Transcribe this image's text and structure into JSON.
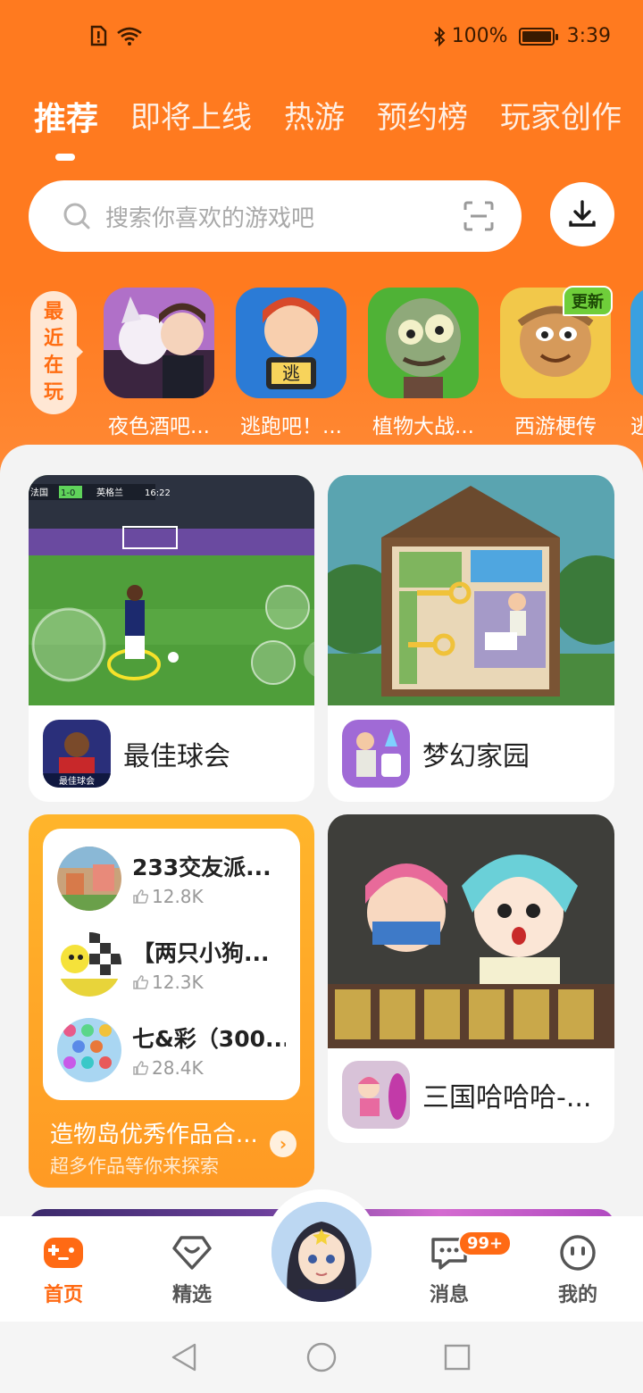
{
  "status_bar": {
    "battery": "100%",
    "time": "3:39"
  },
  "tabs": [
    {
      "label": "推荐"
    },
    {
      "label": "即将上线"
    },
    {
      "label": "热游"
    },
    {
      "label": "预约榜"
    },
    {
      "label": "玩家创作"
    }
  ],
  "search": {
    "placeholder": "搜索你喜欢的游戏吧"
  },
  "recent": {
    "label_chars": [
      "最",
      "近",
      "在",
      "玩"
    ],
    "items": [
      {
        "name": "夜色酒吧..."
      },
      {
        "name": "逃跑吧！..."
      },
      {
        "name": "植物大战..."
      },
      {
        "name": "西游梗传",
        "badge": "更新"
      },
      {
        "name": "逃"
      }
    ]
  },
  "cards": [
    {
      "title": "最佳球会",
      "icon_label": "最佳球会",
      "scoreboard": {
        "team1": "法国",
        "score": "1-0",
        "team2": "英格兰",
        "clock": "16:22"
      }
    },
    {
      "title": "梦幻家园"
    },
    {
      "title": "三国哈哈哈-..."
    }
  ],
  "collection": {
    "items": [
      {
        "title": "233交友派...",
        "likes": "12.8K"
      },
      {
        "title": "【两只小狗...",
        "likes": "12.3K"
      },
      {
        "title": "七&彩（300...",
        "likes": "28.4K"
      }
    ],
    "title": "造物岛优秀作品合...",
    "subtitle": "超多作品等你来探索"
  },
  "bottom_nav": [
    {
      "label": "首页"
    },
    {
      "label": "精选"
    },
    {
      "label": "消息",
      "badge": "99+"
    },
    {
      "label": "我的"
    }
  ],
  "colors": {
    "accent": "#ff7a1f",
    "nav_active": "#ff6a14"
  }
}
